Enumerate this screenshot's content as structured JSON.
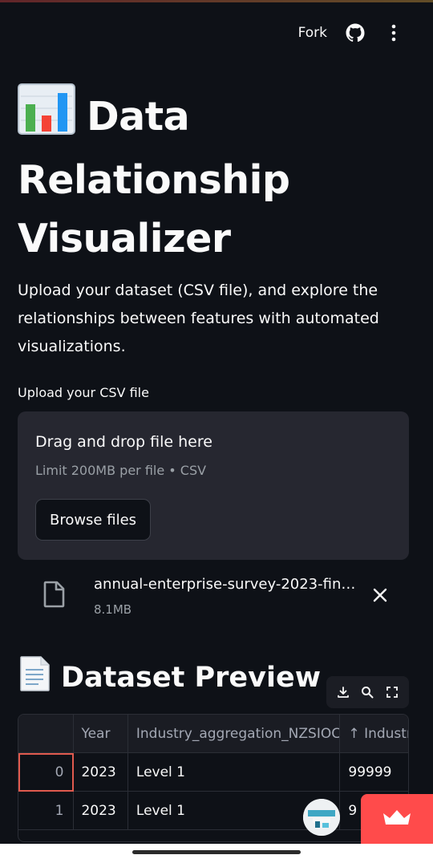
{
  "header": {
    "fork_label": "Fork",
    "github_icon": "github-icon",
    "menu_icon": "more-vertical-icon"
  },
  "page": {
    "title": "Data Relationship Visualizer",
    "title_icon": "bar-chart-emoji",
    "description": "Upload your dataset (CSV file), and explore the relationships between features with automated visualizations."
  },
  "uploader": {
    "label": "Upload your CSV file",
    "drop_text": "Drag and drop file here",
    "limit_text": "Limit 200MB per file • CSV",
    "browse_label": "Browse files",
    "file": {
      "name": "annual-enterprise-survey-2023-fin…",
      "size": "8.1MB"
    }
  },
  "preview": {
    "title": "Dataset Preview",
    "title_icon": "page-facing-up-emoji",
    "toolbar": [
      "download-icon",
      "search-icon",
      "fullscreen-icon"
    ],
    "columns": [
      "",
      "Year",
      "Industry_aggregation_NZSIOC",
      "↑ Industr"
    ],
    "rows": [
      [
        "0",
        "2023",
        "Level 1",
        "99999"
      ],
      [
        "1",
        "2023",
        "Level 1",
        "9"
      ]
    ]
  },
  "colors": {
    "background": "#0e1117",
    "panel": "#262730",
    "accent": "#ff4b4b"
  }
}
